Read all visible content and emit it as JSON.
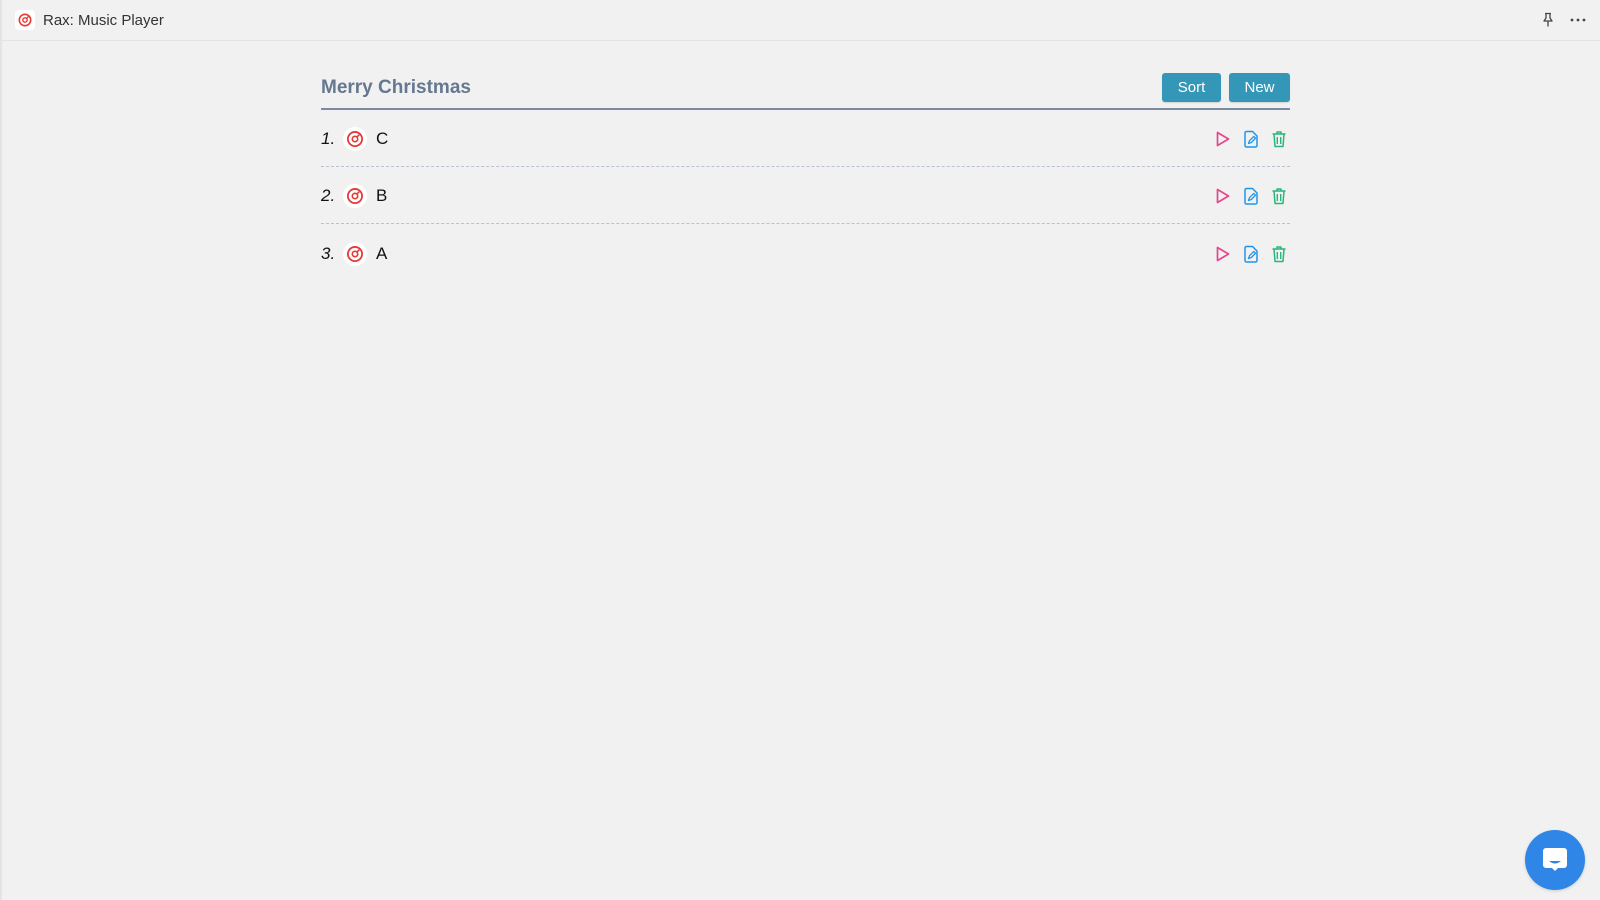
{
  "window": {
    "title": "Rax: Music Player",
    "app_icon": "vinyl-target-icon",
    "actions": [
      {
        "name": "pin",
        "icon": "pin-icon"
      },
      {
        "name": "more",
        "icon": "more-horizontal-icon"
      }
    ]
  },
  "playlist": {
    "title": "Merry Christmas",
    "sort_label": "Sort",
    "new_label": "New",
    "songs": [
      {
        "number": "1.",
        "name": "C"
      },
      {
        "number": "2.",
        "name": "B"
      },
      {
        "number": "3.",
        "name": "A"
      }
    ],
    "row_actions": [
      "play-icon",
      "edit-icon",
      "trash-icon"
    ]
  },
  "colors": {
    "accent_button": "#3597b7",
    "title_color": "#66788f",
    "play": "#e8458f",
    "edit": "#2196e8",
    "delete": "#29b67a",
    "song_icon": "#e53935",
    "chat": "#2f86e6"
  },
  "chat_widget": {
    "icon": "chat-bubble-icon"
  }
}
